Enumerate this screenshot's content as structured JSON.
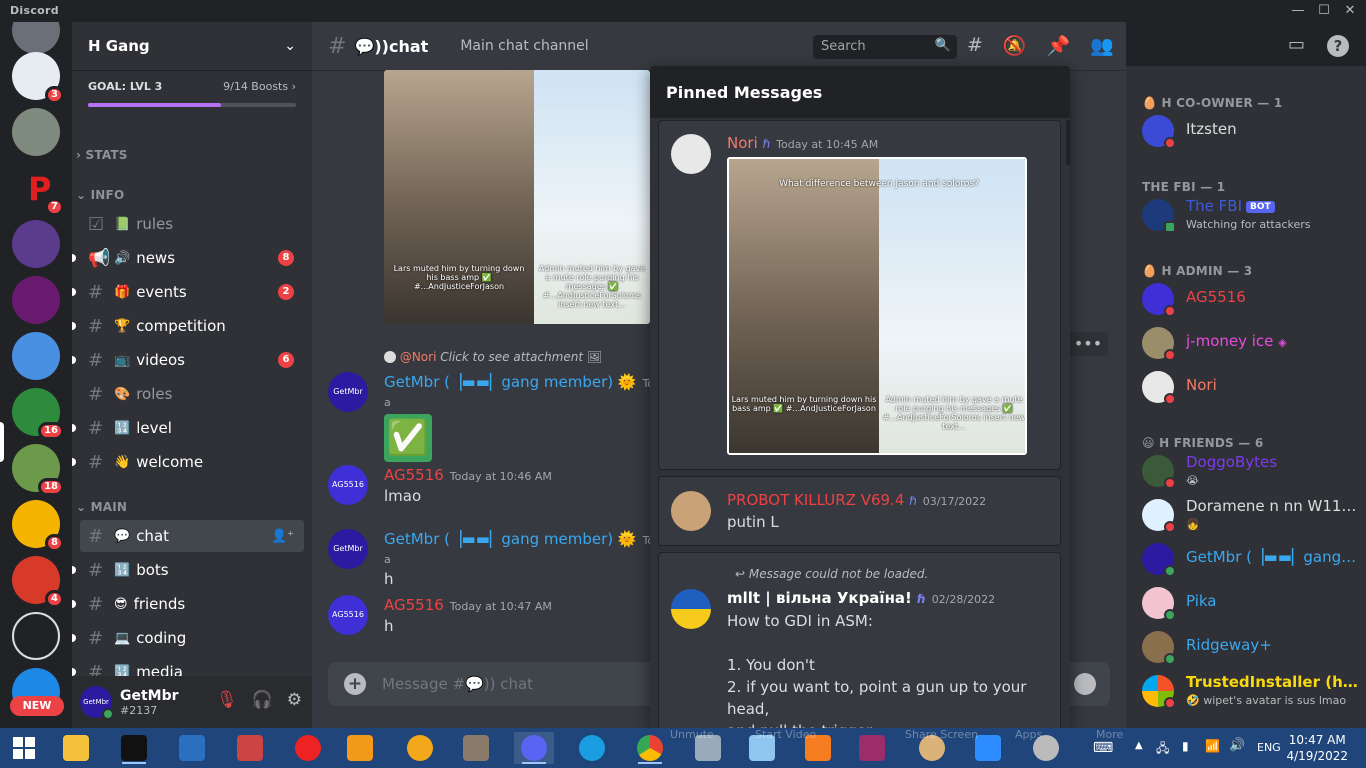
{
  "window": {
    "brand": "Discord"
  },
  "servers": [
    {
      "badge": "3"
    },
    {
      "badge": ""
    },
    {
      "badge": "7"
    },
    {
      "badge": ""
    },
    {
      "badge": ""
    },
    {
      "badge": ""
    },
    {
      "badge": "16"
    },
    {
      "badge": "18"
    },
    {
      "badge": "8"
    },
    {
      "badge": "4"
    },
    {
      "badge": ""
    },
    {
      "badge": ""
    }
  ],
  "new_badge": "NEW",
  "guild": {
    "name": "H Gang",
    "boost_goal": "GOAL: LVL 3",
    "boost_count": "9/14 Boosts",
    "boost_progress": 0.64
  },
  "categories": {
    "stats": "STATS",
    "info": "INFO",
    "main": "MAIN"
  },
  "channels": [
    {
      "label": "rules",
      "emoji": "📗"
    },
    {
      "label": "news",
      "emoji": "🔊",
      "count": "8"
    },
    {
      "label": "events",
      "emoji": "🎁",
      "count": "2"
    },
    {
      "label": "competition",
      "emoji": "🏆"
    },
    {
      "label": "videos",
      "emoji": "📺",
      "count": "6"
    },
    {
      "label": "roles",
      "emoji": "🎨"
    },
    {
      "label": "level",
      "emoji": "🔢"
    },
    {
      "label": "welcome",
      "emoji": "👋"
    },
    {
      "label": "chat",
      "emoji": "💬"
    },
    {
      "label": "bots",
      "emoji": "🔢"
    },
    {
      "label": "friends",
      "emoji": "😎"
    },
    {
      "label": "coding",
      "emoji": "💻"
    },
    {
      "label": "media",
      "emoji": "🔢"
    }
  ],
  "user": {
    "name": "GetMbr",
    "tag": "#2137",
    "avatar_text": "GetMbr"
  },
  "header": {
    "channel": "💬))chat",
    "topic": "Main chat channel",
    "search_placeholder": "Search"
  },
  "meme": {
    "left_caption": "Lars muted him by turning down his bass amp ✅ #...AndJusticeForJason",
    "right_caption": "Admin muted him by gave a mute role purging his messages ✅ #...AndJusticeForSoloros insert new text...",
    "top_caption": "What difference between Jason and soloros?"
  },
  "messages": [
    {
      "reply_user": "@Nori",
      "reply_text": "Click to see attachment",
      "author": "GetMbr (▕▬▬▏gang member) 🌞",
      "time": "Today a",
      "text": "✅",
      "avatar_text": "GetMbr"
    },
    {
      "author": "AG5516",
      "time": "Today at 10:46 AM",
      "text": "lmao",
      "avatar_text": "AG5516"
    },
    {
      "author": "GetMbr (▕▬▬▏gang member) 🌞",
      "time": "Today a",
      "text": "h",
      "avatar_text": "GetMbr"
    },
    {
      "author": "AG5516",
      "time": "Today at 10:47 AM",
      "text": "h",
      "avatar_text": "AG5516"
    }
  ],
  "input": {
    "placeholder": "Message #💬)) chat"
  },
  "pinned": {
    "title": "Pinned Messages",
    "items": [
      {
        "author": "Nori",
        "time": "Today at 10:45 AM",
        "text": ""
      },
      {
        "author": "PROBOT KILLURZ V69.4",
        "time": "03/17/2022",
        "text": "putin L"
      },
      {
        "reply_text": "Message could not be loaded.",
        "author": "mllt | вільна Україна!",
        "time": "02/28/2022",
        "lines": [
          "How to GDI in ASM:",
          "",
          "1. You don't",
          "2. if you want to, point a gun up to your head,",
          "and pull the trigger"
        ]
      }
    ]
  },
  "members": {
    "groups": [
      {
        "label": "H CO-OWNER — 1",
        "members": [
          {
            "name": "Itzsten",
            "color": "#dcddde"
          }
        ]
      },
      {
        "label": "THE FBI — 1",
        "members": [
          {
            "name": "The FBI",
            "color": "#3b5bdb",
            "bot": "BOT",
            "sub": "Watching for attackers"
          }
        ]
      },
      {
        "label": "H ADMIN — 3",
        "members": [
          {
            "name": "AG5516",
            "color": "#ed4245"
          },
          {
            "name": "j-money ice",
            "color": "#e84cde"
          },
          {
            "name": "Nori",
            "color": "#f47b67"
          }
        ]
      },
      {
        "label": "H FRIENDS — 6",
        "members": [
          {
            "name": "DoggoBytes",
            "color": "#7c3aed",
            "sub": "😭"
          },
          {
            "name": "Doramene n nn W11 U...",
            "color": "#dcddde",
            "sub": "👧"
          },
          {
            "name": "GetMbr (▕▬▬▏gang ...",
            "color": "#3aa8f0"
          },
          {
            "name": "Pika",
            "color": "#3aa8f0"
          },
          {
            "name": "Ridgeway+",
            "color": "#3aa8f0"
          },
          {
            "name": "TrustedInstaller (h Fri...",
            "color": "#f8d90f",
            "sub": "🤣 wipet's avatar is sus lmao"
          }
        ]
      }
    ]
  },
  "taskbar": {
    "time": "10:47 AM",
    "date": "4/19/2022",
    "lang": "ENG",
    "ghost_labels": [
      "Unmute",
      "Start Video",
      "Share Screen",
      "Apps",
      "More"
    ]
  },
  "colors": {
    "accent": "#5865f2",
    "boost": "#b473f5",
    "danger": "#ed4245",
    "online": "#3ba55d"
  }
}
